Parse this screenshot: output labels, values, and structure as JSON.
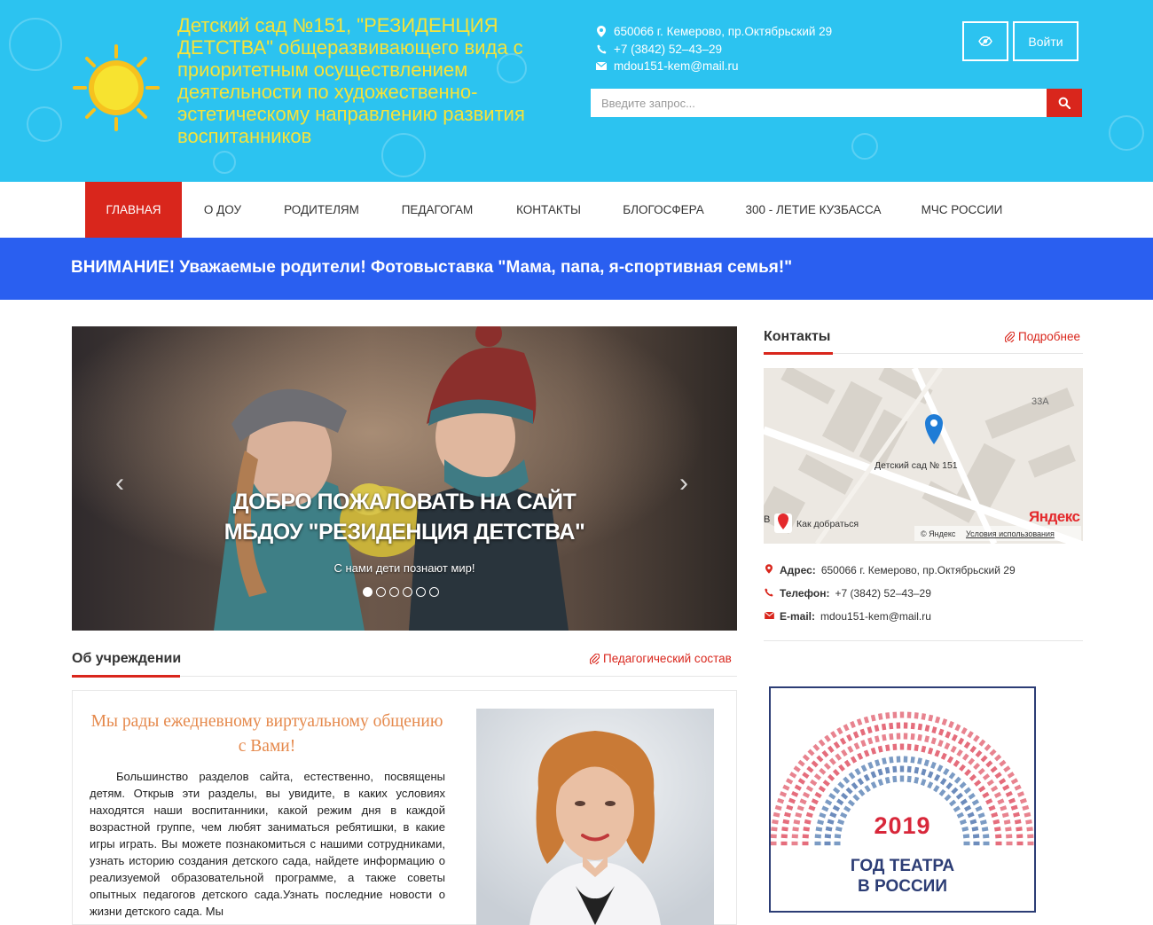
{
  "header": {
    "site_title": "Детский сад №151, \"РЕЗИДЕНЦИЯ ДЕТСТВА\" общеразвивающего вида с приоритетным осуществлением деятельности по художественно-эстетическому направлению развития воспитанников",
    "address": "650066 г. Кемерово, пр.Октябрьский 29",
    "phone": "+7 (3842) 52–43–29",
    "email": "mdou151-kem@mail.ru",
    "login_label": "Войти",
    "search_placeholder": "Введите запрос...",
    "icons": {
      "address": "map-marker-icon",
      "phone": "phone-icon",
      "email": "envelope-icon",
      "accessibility": "eye-icon",
      "search": "search-icon"
    },
    "accent_color": "#d9261c",
    "bg_color": "#2cc3f0",
    "title_color": "#f6e33a"
  },
  "nav": {
    "items": [
      "Главная",
      "О ДОУ",
      "Родителям",
      "Педагогам",
      "Контакты",
      "Блогосфера",
      "300 - летие Кузбасса",
      "МЧС России"
    ],
    "active_index": 0
  },
  "notice": {
    "text": "ВНИМАНИЕ! Уважаемые родители! Фотовыставка \"Мама, папа, я-спортивная семья!\"",
    "color": "#2a5ff0"
  },
  "slider": {
    "title_line1": "ДОБРО ПОЖАЛОВАТЬ НА САЙТ",
    "title_line2": "МБДОУ \"РЕЗИДЕНЦИЯ ДЕТСТВА\"",
    "subtitle": "С нами дети познают мир!",
    "prev": "‹",
    "next": "›",
    "slide_count": 6,
    "active_slide": 0
  },
  "about": {
    "title": "Об учреждении",
    "link": "Педагогический состав",
    "heading": "Мы рады ежедневному виртуальному общению с Вами!",
    "text": "Большинство разделов сайта, естественно, посвящены детям. Открыв эти разделы, вы увидите, в каких условиях находятся наши воспитанники, какой режим дня в каждой возрастной группе, чем любят заниматься ребятишки, в какие игры играть. Вы можете познакомиться с нашими сотрудниками, узнать историю создания детского сада, найдете информацию о реализуемой образовательной программе, а также советы опытных педагогов детского сада.Узнать последние новости о жизни детского сада. Мы"
  },
  "contacts": {
    "title": "Контакты",
    "link": "Подробнее",
    "map": {
      "place": "Детский сад № 151",
      "building": "33А",
      "route": "Как добраться",
      "brand": "Яндекс",
      "copyright": "© Яндекс",
      "terms": "Условия использования",
      "edge_letter": "В"
    },
    "address_label": "Адрес:",
    "address": "650066 г. Кемерово, пр.Октябрьский 29",
    "phone_label": "Телефон:",
    "phone": "+7 (3842) 52–43–29",
    "email_label": "E-mail:",
    "email": "mdou151-kem@mail.ru"
  },
  "banner": {
    "year": "2019",
    "line1": "ГОД ТЕАТРА",
    "line2": "В РОССИИ"
  }
}
